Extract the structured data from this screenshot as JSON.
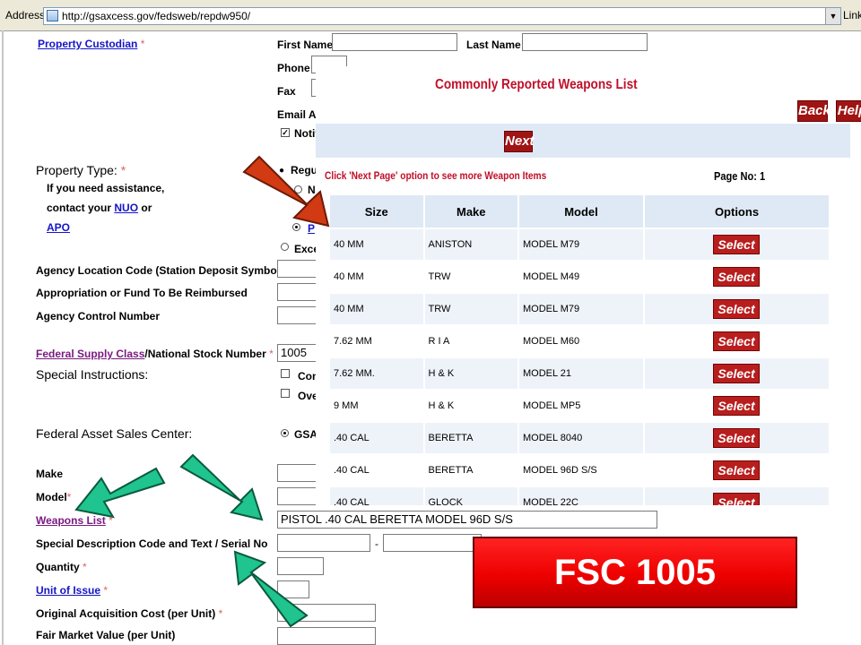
{
  "address_bar": {
    "label": "Address",
    "url": "http://gsaxcess.gov/fedsweb/repdw950/",
    "links_label": "Link"
  },
  "form": {
    "property_custodian": "Property Custodian",
    "first_name": "First Name",
    "last_name": "Last Name",
    "phone": "Phone",
    "fax": "Fax",
    "email": "Email Ac",
    "notify": "Notif",
    "property_type": "Property Type:",
    "assist_1": "If you need assistance,",
    "assist_2": "contact your",
    "nuo": "NUO",
    "or": "or",
    "apo": "APO",
    "radio_regular": "Regu",
    "radio_n": "N",
    "radio_p": "P",
    "radio_exce": "Exce",
    "agency_location_code": "Agency Location Code (Station Deposit Symbol)",
    "appropriation": "Appropriation or Fund To Be Reimbursed",
    "agency_control": "Agency Control Number",
    "federal_supply_class": "Federal Supply Class",
    "national_stock_number": "/National Stock Number",
    "fsc_value": "1005",
    "special_instructions": "Special Instructions:",
    "check_con": "Con",
    "check_ove": "Ove",
    "federal_asset_sales_center": "Federal Asset Sales Center:",
    "gsa": "GSA",
    "make": "Make",
    "model": "Model",
    "weapons_list": "Weapons List",
    "weapons_value": "PISTOL        .40 CAL  BERETTA    MODEL 96D S/S",
    "special_description": "Special Description Code and Text / Serial No",
    "dash": "-",
    "quantity": "Quantity",
    "unit_of_issue": "Unit of Issue",
    "original_cost": "Original Acquisition Cost (per Unit)",
    "fair_market": "Fair Market Value (per Unit)",
    "required_mark": "*"
  },
  "popup": {
    "title": "Commonly Reported Weapons List",
    "back": "Back",
    "help": "Help",
    "next": "Next",
    "hint": "Click 'Next Page' option to see more Weapon Items",
    "page_no_label": "Page No:",
    "page_no": "1",
    "columns": [
      "Size",
      "Make",
      "Model",
      "Options"
    ],
    "select_label": "Select",
    "rows": [
      {
        "size": "40 MM",
        "make": "ANISTON",
        "model": "MODEL M79"
      },
      {
        "size": "40 MM",
        "make": "TRW",
        "model": "MODEL M49"
      },
      {
        "size": "40 MM",
        "make": "TRW",
        "model": "MODEL M79"
      },
      {
        "size": "7.62 MM",
        "make": "R I A",
        "model": "MODEL M60"
      },
      {
        "size": "7.62 MM.",
        "make": "H & K",
        "model": "MODEL 21"
      },
      {
        "size": "9 MM",
        "make": "H & K",
        "model": "MODEL MP5"
      },
      {
        "size": ".40 CAL",
        "make": "BERETTA",
        "model": "MODEL 8040"
      },
      {
        "size": ".40 CAL",
        "make": "BERETTA",
        "model": "MODEL 96D S/S"
      },
      {
        "size": ".40 CAL",
        "make": "GLOCK",
        "model": "MODEL 22C"
      }
    ]
  },
  "banner": {
    "text": "FSC 1005"
  },
  "colors": {
    "arrow_red": "#d13a12",
    "arrow_green": "#1fc48e",
    "popup_title": "#c0102a",
    "button_red": "#a01414"
  }
}
